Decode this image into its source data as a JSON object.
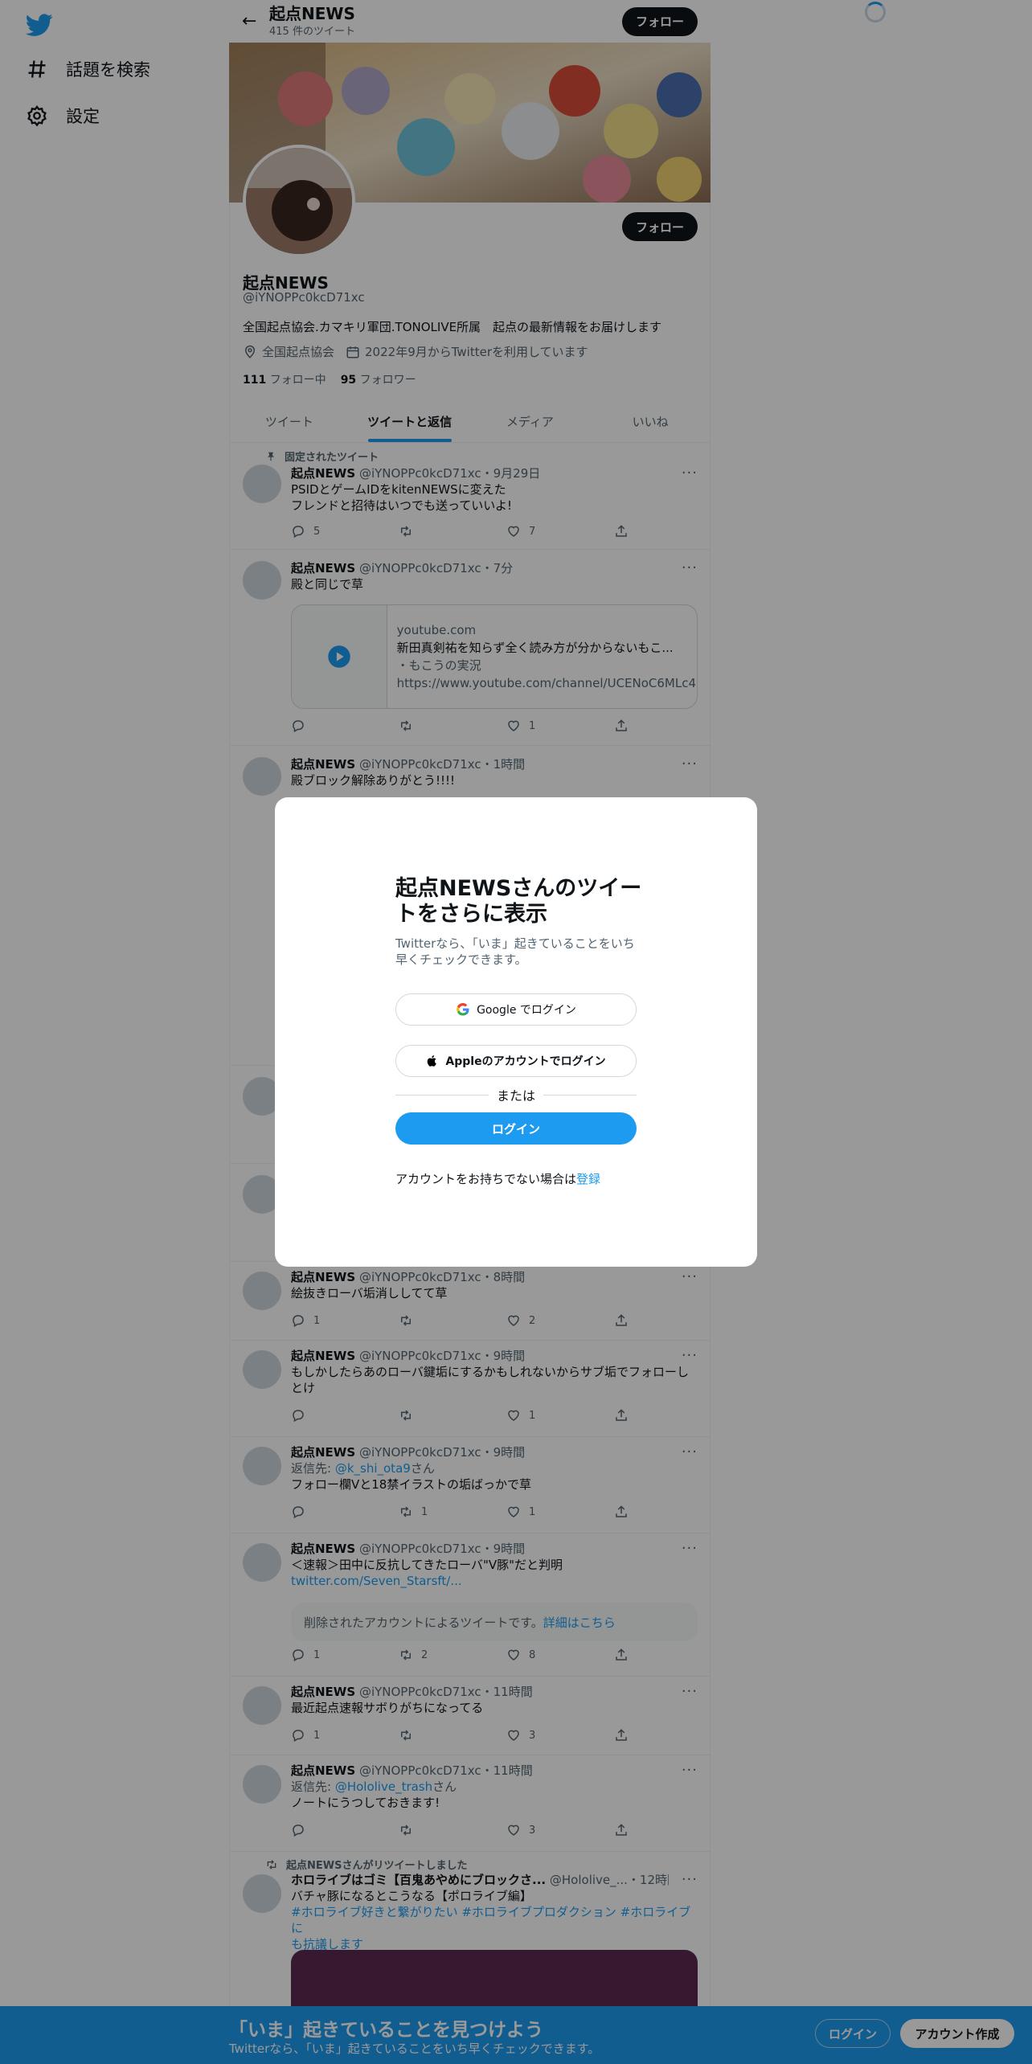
{
  "colors": {
    "accent": "#1d9bf0",
    "text": "#0f1419",
    "muted": "#536471",
    "bottom_bar": "#1d9bf0"
  },
  "sidebar": {
    "items": [
      {
        "label": "話題を検索",
        "icon": "hashtag-icon"
      },
      {
        "label": "設定",
        "icon": "gear-icon"
      }
    ]
  },
  "header": {
    "name": "起点NEWS",
    "tweet_count": "415 件のツイート",
    "follow_label": "フォロー"
  },
  "profile": {
    "name": "起点NEWS",
    "handle": "@iYNOPPc0kcD71xc",
    "bio": "全国起点協会.カマキリ軍団.TONOLIVE所属　起点の最新情報をお届けします",
    "location": "全国起点協会",
    "joined": "2022年9月からTwitterを利用しています",
    "following_count": "111",
    "following_label": "フォロー中",
    "followers_count": "95",
    "followers_label": "フォロワー",
    "follow_label": "フォロー"
  },
  "tabs": [
    {
      "label": "ツイート"
    },
    {
      "label": "ツイートと返信"
    },
    {
      "label": "メディア"
    },
    {
      "label": "いいね"
    }
  ],
  "tweets": [
    {
      "pinned_label": "固定されたツイート",
      "name": "起点NEWS",
      "meta": "@iYNOPPc0kcD71xc・9月29日",
      "text1": "PSIDとゲームIDをkitenNEWSに変えた",
      "text2": "フレンドと招待はいつでも送っていいよ!",
      "replies": "5",
      "retweets": "",
      "likes": "7"
    },
    {
      "name": "起点NEWS",
      "meta": "@iYNOPPc0kcD71xc・7分",
      "text1": "殿と同じで草",
      "card_domain": "youtube.com",
      "card_title": "新田真剣祐を知らず全く読み方が分からないもこ...",
      "card_desc": "・もこうの実況",
      "card_url": "https://www.youtube.com/channel/UCENoC6MLc4p...",
      "replies": "",
      "retweets": "",
      "likes": "1"
    },
    {
      "name": "起点NEWS",
      "meta": "@iYNOPPc0kcD71xc・1時間",
      "text1": "殿ブロック解除ありがとう!!!!"
    },
    {
      "name": "起点NEWS",
      "meta": "@iYNOPPc0kcD71xc・8時間",
      "text1": "絵抜きローバ垢消ししてて草",
      "replies": "1",
      "retweets": "",
      "likes": "2"
    },
    {
      "name": "起点NEWS",
      "meta": "@iYNOPPc0kcD71xc・9時間",
      "text1": "もしかしたらあのローバ鍵垢にするかもしれないからサブ垢でフォローし",
      "text2": "とけ",
      "replies": "",
      "retweets": "",
      "likes": "1"
    },
    {
      "name": "起点NEWS",
      "meta": "@iYNOPPc0kcD71xc・9時間",
      "reply_prefix": "返信先: ",
      "reply_to": "@k_shi_ota9",
      "reply_suffix": "さん",
      "text1": "フォロー欄Vと18禁イラストの垢ばっかで草",
      "replies": "",
      "retweets": "1",
      "likes": "1"
    },
    {
      "name": "起点NEWS",
      "meta": "@iYNOPPc0kcD71xc・9時間",
      "text1": "＜速報＞田中に反抗してきたローバ\"V豚\"だと判明",
      "link": "twitter.com/Seven_Starsft/...",
      "deleted_text": "削除されたアカウントによるツイートです。",
      "deleted_link": "詳細はこちら",
      "replies": "1",
      "retweets": "2",
      "likes": "8"
    },
    {
      "name": "起点NEWS",
      "meta": "@iYNOPPc0kcD71xc・11時間",
      "text1": "最近起点速報サボりがちになってる",
      "replies": "1",
      "retweets": "",
      "likes": "3"
    },
    {
      "name": "起点NEWS",
      "meta": "@iYNOPPc0kcD71xc・11時間",
      "reply_prefix": "返信先: ",
      "reply_to": "@Hololive_trash",
      "reply_suffix": "さん",
      "text1": "ノートにうつしておきます!",
      "replies": "",
      "retweets": "",
      "likes": "3"
    },
    {
      "retweeted_label": "起点NEWSさんがリツイートしました",
      "name": "ホロライブはゴミ【百鬼あやめにブロックさ...",
      "meta": "@Hololive_...・12時間",
      "text1": "バチャ豚になるとこうなる【ポロライブ編】",
      "hashtags1": "#ホロライブ好きと繋がりたい #ホロライブプロダクション #ホロライブに",
      "hashtags2": "も抗議します"
    }
  ],
  "modal": {
    "title": "起点NEWSさんのツイートをさらに表示",
    "subtitle": "Twitterなら、「いま」起きていることをいち早くチェックできます。",
    "google_label": "Google でログイン",
    "apple_label": "Appleのアカウントでログイン",
    "or_label": "または",
    "login_label": "ログイン",
    "no_account": "アカウントをお持ちでない場合は",
    "signup_link": "登録"
  },
  "bottom_bar": {
    "title": "「いま」起きていることを見つけよう",
    "subtitle": "Twitterなら、「いま」起きていることをいち早くチェックできます。",
    "login_label": "ログイン",
    "signup_label": "アカウント作成"
  }
}
